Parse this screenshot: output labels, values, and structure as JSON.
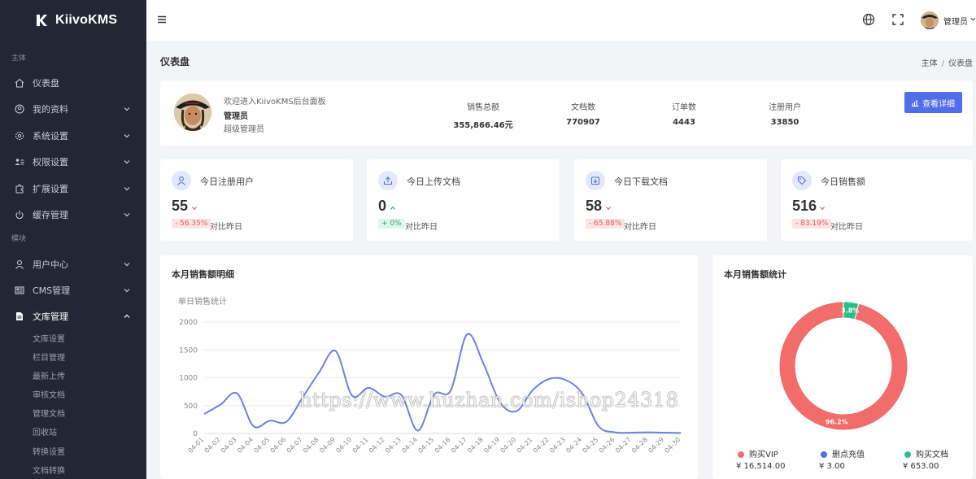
{
  "brand": {
    "name": "KiivoKMS"
  },
  "sidebar": {
    "section_main": "主体",
    "section_module": "模块",
    "items": [
      {
        "label": "仪表盘"
      },
      {
        "label": "我的资料"
      },
      {
        "label": "系统设置"
      },
      {
        "label": "权限设置"
      },
      {
        "label": "扩展设置"
      },
      {
        "label": "缓存管理"
      },
      {
        "label": "用户中心"
      },
      {
        "label": "CMS管理"
      },
      {
        "label": "文库管理"
      }
    ],
    "subitems": [
      "文库设置",
      "栏目管理",
      "最新上传",
      "审核文档",
      "管理文档",
      "回收站",
      "转换设置",
      "文档转换"
    ]
  },
  "topbar": {
    "user": "管理员"
  },
  "page": {
    "title": "仪表盘",
    "breadcrumb": [
      "主体",
      "仪表盘"
    ]
  },
  "welcome": {
    "greeting": "欢迎进入KiivoKMS后台面板",
    "name": "管理员",
    "role": "超级管理员",
    "button": "查看详细",
    "stats": [
      {
        "label": "销售总额",
        "value": "355,866.46元"
      },
      {
        "label": "文档数",
        "value": "770907"
      },
      {
        "label": "订单数",
        "value": "4443"
      },
      {
        "label": "注册用户",
        "value": "33850"
      }
    ]
  },
  "kpis": [
    {
      "title": "今日注册用户",
      "value": "55",
      "trend": "down",
      "change": "- 56.35%",
      "compare": "对比昨日",
      "icon": "user-icon"
    },
    {
      "title": "今日上传文档",
      "value": "0",
      "trend": "up",
      "change": "+ 0%",
      "compare": "对比昨日",
      "icon": "upload-icon"
    },
    {
      "title": "今日下载文档",
      "value": "58",
      "trend": "down",
      "change": "- 65.88%",
      "compare": "对比昨日",
      "icon": "download-icon"
    },
    {
      "title": "今日销售额",
      "value": "516",
      "trend": "down",
      "change": "- 83.19%",
      "compare": "对比昨日",
      "icon": "tag-icon"
    }
  ],
  "sales_chart": {
    "title": "本月销售额明细",
    "subtitle": "单日销售统计"
  },
  "donut_chart": {
    "title": "本月销售额统计"
  },
  "watermark": "https://www.huzhan.com/ishop24318",
  "chart_data": [
    {
      "type": "line",
      "title": "单日销售统计",
      "categories": [
        "04-01",
        "04-02",
        "04-03",
        "04-04",
        "04-05",
        "04-06",
        "04-07",
        "04-08",
        "04-09",
        "04-10",
        "04-11",
        "04-12",
        "04-13",
        "04-14",
        "04-15",
        "04-16",
        "04-17",
        "04-18",
        "04-19",
        "04-20",
        "04-21",
        "04-22",
        "04-23",
        "04-24",
        "04-25",
        "04-26",
        "04-27",
        "04-28",
        "04-29",
        "04-30"
      ],
      "series": [
        {
          "values": [
            350,
            520,
            720,
            130,
            230,
            210,
            650,
            1100,
            1480,
            680,
            820,
            660,
            690,
            50,
            700,
            770,
            1780,
            1250,
            560,
            400,
            780,
            980,
            960,
            720,
            130,
            20,
            15,
            20,
            15,
            10
          ]
        }
      ],
      "yticks": [
        0,
        500,
        1000,
        1500,
        2000
      ],
      "ylim": [
        0,
        2000
      ],
      "color": "#6c82e0",
      "grid": true
    },
    {
      "type": "pie",
      "slices": [
        {
          "label": "购买VIP",
          "value": 16514.0,
          "display": "¥ 16,514.00",
          "percent": "96.2%",
          "color": "#f26c6c"
        },
        {
          "label": "删点充值",
          "value": 3.0,
          "display": "¥ 3.00",
          "percent": "",
          "color": "#4f6ee8"
        },
        {
          "label": "购买文档",
          "value": 653.0,
          "display": "¥ 653.00",
          "percent": "3.8%",
          "color": "#2bbf8a"
        }
      ]
    }
  ]
}
